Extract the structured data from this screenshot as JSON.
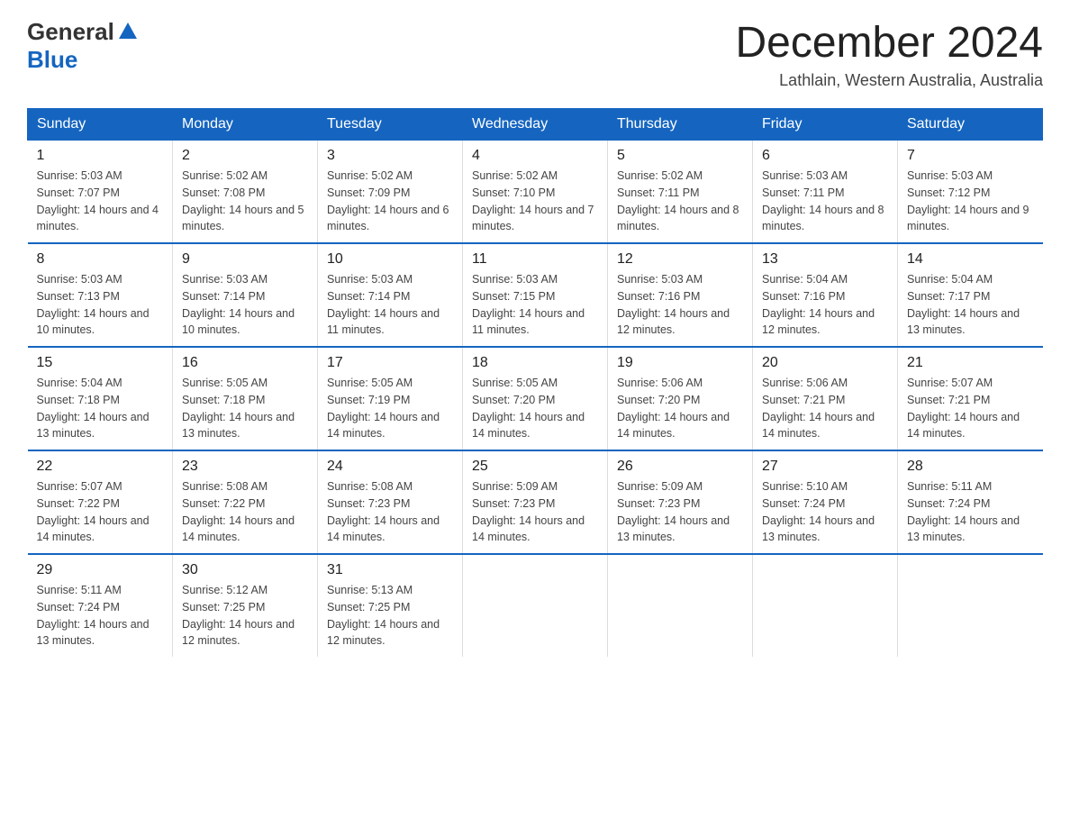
{
  "logo": {
    "text_general": "General",
    "text_blue": "Blue"
  },
  "title": "December 2024",
  "subtitle": "Lathlain, Western Australia, Australia",
  "weekdays": [
    "Sunday",
    "Monday",
    "Tuesday",
    "Wednesday",
    "Thursday",
    "Friday",
    "Saturday"
  ],
  "weeks": [
    [
      {
        "day": "1",
        "sunrise": "5:03 AM",
        "sunset": "7:07 PM",
        "daylight": "14 hours and 4 minutes."
      },
      {
        "day": "2",
        "sunrise": "5:02 AM",
        "sunset": "7:08 PM",
        "daylight": "14 hours and 5 minutes."
      },
      {
        "day": "3",
        "sunrise": "5:02 AM",
        "sunset": "7:09 PM",
        "daylight": "14 hours and 6 minutes."
      },
      {
        "day": "4",
        "sunrise": "5:02 AM",
        "sunset": "7:10 PM",
        "daylight": "14 hours and 7 minutes."
      },
      {
        "day": "5",
        "sunrise": "5:02 AM",
        "sunset": "7:11 PM",
        "daylight": "14 hours and 8 minutes."
      },
      {
        "day": "6",
        "sunrise": "5:03 AM",
        "sunset": "7:11 PM",
        "daylight": "14 hours and 8 minutes."
      },
      {
        "day": "7",
        "sunrise": "5:03 AM",
        "sunset": "7:12 PM",
        "daylight": "14 hours and 9 minutes."
      }
    ],
    [
      {
        "day": "8",
        "sunrise": "5:03 AM",
        "sunset": "7:13 PM",
        "daylight": "14 hours and 10 minutes."
      },
      {
        "day": "9",
        "sunrise": "5:03 AM",
        "sunset": "7:14 PM",
        "daylight": "14 hours and 10 minutes."
      },
      {
        "day": "10",
        "sunrise": "5:03 AM",
        "sunset": "7:14 PM",
        "daylight": "14 hours and 11 minutes."
      },
      {
        "day": "11",
        "sunrise": "5:03 AM",
        "sunset": "7:15 PM",
        "daylight": "14 hours and 11 minutes."
      },
      {
        "day": "12",
        "sunrise": "5:03 AM",
        "sunset": "7:16 PM",
        "daylight": "14 hours and 12 minutes."
      },
      {
        "day": "13",
        "sunrise": "5:04 AM",
        "sunset": "7:16 PM",
        "daylight": "14 hours and 12 minutes."
      },
      {
        "day": "14",
        "sunrise": "5:04 AM",
        "sunset": "7:17 PM",
        "daylight": "14 hours and 13 minutes."
      }
    ],
    [
      {
        "day": "15",
        "sunrise": "5:04 AM",
        "sunset": "7:18 PM",
        "daylight": "14 hours and 13 minutes."
      },
      {
        "day": "16",
        "sunrise": "5:05 AM",
        "sunset": "7:18 PM",
        "daylight": "14 hours and 13 minutes."
      },
      {
        "day": "17",
        "sunrise": "5:05 AM",
        "sunset": "7:19 PM",
        "daylight": "14 hours and 14 minutes."
      },
      {
        "day": "18",
        "sunrise": "5:05 AM",
        "sunset": "7:20 PM",
        "daylight": "14 hours and 14 minutes."
      },
      {
        "day": "19",
        "sunrise": "5:06 AM",
        "sunset": "7:20 PM",
        "daylight": "14 hours and 14 minutes."
      },
      {
        "day": "20",
        "sunrise": "5:06 AM",
        "sunset": "7:21 PM",
        "daylight": "14 hours and 14 minutes."
      },
      {
        "day": "21",
        "sunrise": "5:07 AM",
        "sunset": "7:21 PM",
        "daylight": "14 hours and 14 minutes."
      }
    ],
    [
      {
        "day": "22",
        "sunrise": "5:07 AM",
        "sunset": "7:22 PM",
        "daylight": "14 hours and 14 minutes."
      },
      {
        "day": "23",
        "sunrise": "5:08 AM",
        "sunset": "7:22 PM",
        "daylight": "14 hours and 14 minutes."
      },
      {
        "day": "24",
        "sunrise": "5:08 AM",
        "sunset": "7:23 PM",
        "daylight": "14 hours and 14 minutes."
      },
      {
        "day": "25",
        "sunrise": "5:09 AM",
        "sunset": "7:23 PM",
        "daylight": "14 hours and 14 minutes."
      },
      {
        "day": "26",
        "sunrise": "5:09 AM",
        "sunset": "7:23 PM",
        "daylight": "14 hours and 13 minutes."
      },
      {
        "day": "27",
        "sunrise": "5:10 AM",
        "sunset": "7:24 PM",
        "daylight": "14 hours and 13 minutes."
      },
      {
        "day": "28",
        "sunrise": "5:11 AM",
        "sunset": "7:24 PM",
        "daylight": "14 hours and 13 minutes."
      }
    ],
    [
      {
        "day": "29",
        "sunrise": "5:11 AM",
        "sunset": "7:24 PM",
        "daylight": "14 hours and 13 minutes."
      },
      {
        "day": "30",
        "sunrise": "5:12 AM",
        "sunset": "7:25 PM",
        "daylight": "14 hours and 12 minutes."
      },
      {
        "day": "31",
        "sunrise": "5:13 AM",
        "sunset": "7:25 PM",
        "daylight": "14 hours and 12 minutes."
      },
      null,
      null,
      null,
      null
    ]
  ],
  "labels": {
    "sunrise": "Sunrise:",
    "sunset": "Sunset:",
    "daylight": "Daylight:"
  }
}
